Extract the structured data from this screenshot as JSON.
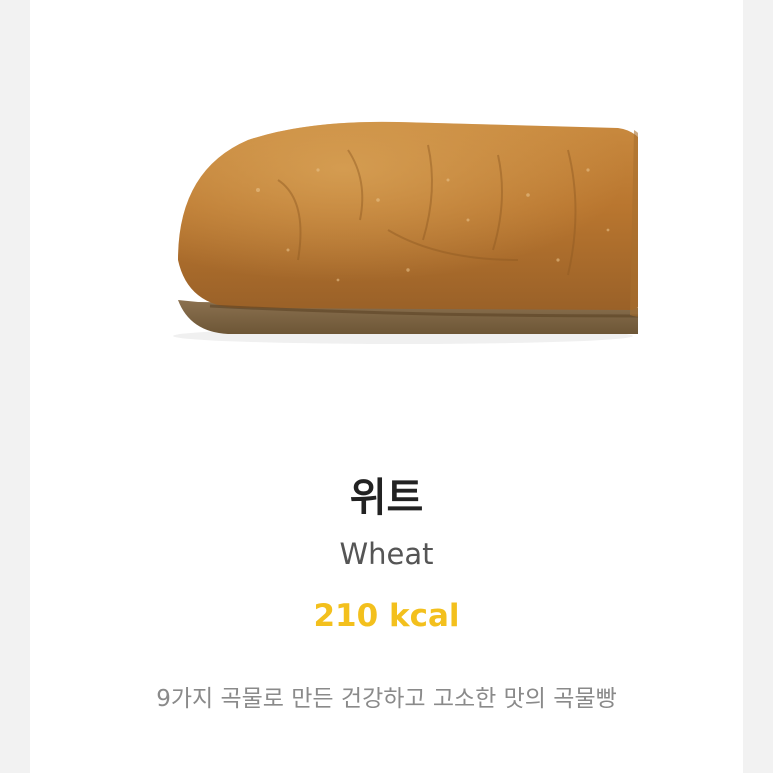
{
  "product": {
    "name_ko": "위트",
    "name_en": "Wheat",
    "calories": "210 kcal",
    "description": "9가지 곡물로 만든 건강하고 고소한 맛의 곡물빵",
    "image_icon": "wheat-bread-image"
  },
  "colors": {
    "background": "#ffffff",
    "accent": "#f3c01d",
    "title": "#222222",
    "subtitle": "#555555",
    "description": "#8a8a8a"
  }
}
